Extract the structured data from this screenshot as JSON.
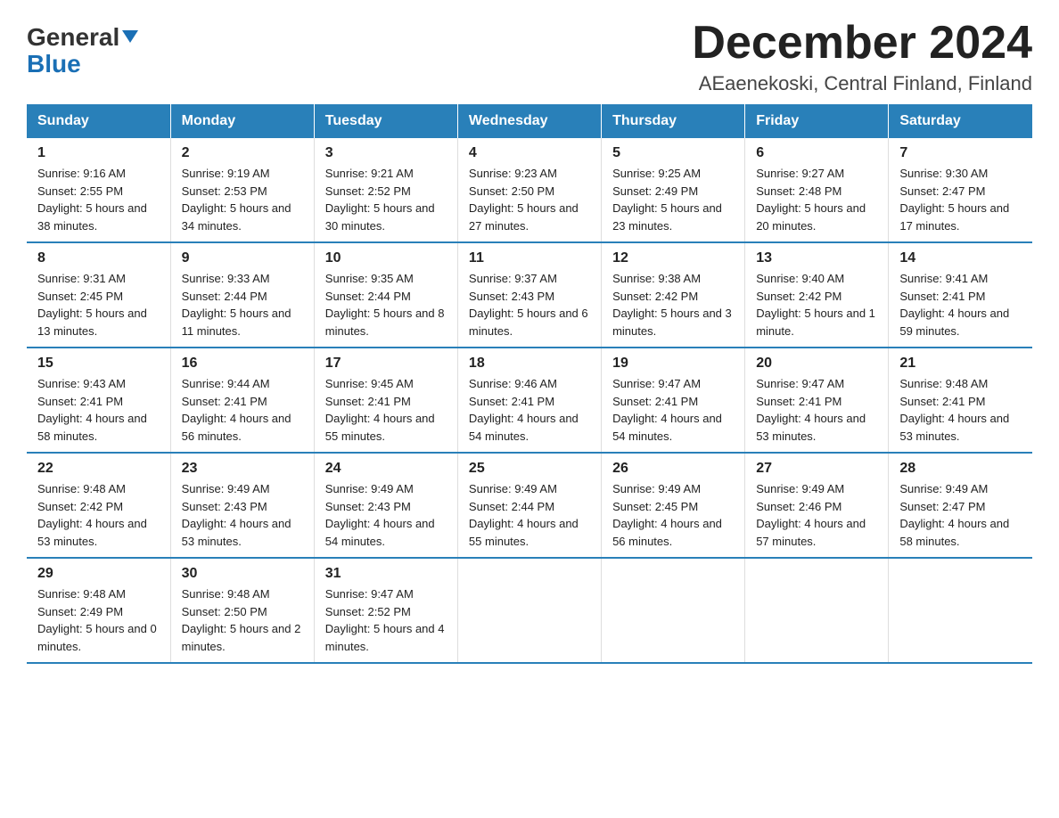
{
  "header": {
    "logo_general": "General",
    "logo_blue": "Blue",
    "title": "December 2024",
    "subtitle": "AEaenekoski, Central Finland, Finland"
  },
  "weekdays": [
    "Sunday",
    "Monday",
    "Tuesday",
    "Wednesday",
    "Thursday",
    "Friday",
    "Saturday"
  ],
  "weeks": [
    [
      {
        "day": "1",
        "sunrise": "9:16 AM",
        "sunset": "2:55 PM",
        "daylight": "5 hours and 38 minutes."
      },
      {
        "day": "2",
        "sunrise": "9:19 AM",
        "sunset": "2:53 PM",
        "daylight": "5 hours and 34 minutes."
      },
      {
        "day": "3",
        "sunrise": "9:21 AM",
        "sunset": "2:52 PM",
        "daylight": "5 hours and 30 minutes."
      },
      {
        "day": "4",
        "sunrise": "9:23 AM",
        "sunset": "2:50 PM",
        "daylight": "5 hours and 27 minutes."
      },
      {
        "day": "5",
        "sunrise": "9:25 AM",
        "sunset": "2:49 PM",
        "daylight": "5 hours and 23 minutes."
      },
      {
        "day": "6",
        "sunrise": "9:27 AM",
        "sunset": "2:48 PM",
        "daylight": "5 hours and 20 minutes."
      },
      {
        "day": "7",
        "sunrise": "9:30 AM",
        "sunset": "2:47 PM",
        "daylight": "5 hours and 17 minutes."
      }
    ],
    [
      {
        "day": "8",
        "sunrise": "9:31 AM",
        "sunset": "2:45 PM",
        "daylight": "5 hours and 13 minutes."
      },
      {
        "day": "9",
        "sunrise": "9:33 AM",
        "sunset": "2:44 PM",
        "daylight": "5 hours and 11 minutes."
      },
      {
        "day": "10",
        "sunrise": "9:35 AM",
        "sunset": "2:44 PM",
        "daylight": "5 hours and 8 minutes."
      },
      {
        "day": "11",
        "sunrise": "9:37 AM",
        "sunset": "2:43 PM",
        "daylight": "5 hours and 6 minutes."
      },
      {
        "day": "12",
        "sunrise": "9:38 AM",
        "sunset": "2:42 PM",
        "daylight": "5 hours and 3 minutes."
      },
      {
        "day": "13",
        "sunrise": "9:40 AM",
        "sunset": "2:42 PM",
        "daylight": "5 hours and 1 minute."
      },
      {
        "day": "14",
        "sunrise": "9:41 AM",
        "sunset": "2:41 PM",
        "daylight": "4 hours and 59 minutes."
      }
    ],
    [
      {
        "day": "15",
        "sunrise": "9:43 AM",
        "sunset": "2:41 PM",
        "daylight": "4 hours and 58 minutes."
      },
      {
        "day": "16",
        "sunrise": "9:44 AM",
        "sunset": "2:41 PM",
        "daylight": "4 hours and 56 minutes."
      },
      {
        "day": "17",
        "sunrise": "9:45 AM",
        "sunset": "2:41 PM",
        "daylight": "4 hours and 55 minutes."
      },
      {
        "day": "18",
        "sunrise": "9:46 AM",
        "sunset": "2:41 PM",
        "daylight": "4 hours and 54 minutes."
      },
      {
        "day": "19",
        "sunrise": "9:47 AM",
        "sunset": "2:41 PM",
        "daylight": "4 hours and 54 minutes."
      },
      {
        "day": "20",
        "sunrise": "9:47 AM",
        "sunset": "2:41 PM",
        "daylight": "4 hours and 53 minutes."
      },
      {
        "day": "21",
        "sunrise": "9:48 AM",
        "sunset": "2:41 PM",
        "daylight": "4 hours and 53 minutes."
      }
    ],
    [
      {
        "day": "22",
        "sunrise": "9:48 AM",
        "sunset": "2:42 PM",
        "daylight": "4 hours and 53 minutes."
      },
      {
        "day": "23",
        "sunrise": "9:49 AM",
        "sunset": "2:43 PM",
        "daylight": "4 hours and 53 minutes."
      },
      {
        "day": "24",
        "sunrise": "9:49 AM",
        "sunset": "2:43 PM",
        "daylight": "4 hours and 54 minutes."
      },
      {
        "day": "25",
        "sunrise": "9:49 AM",
        "sunset": "2:44 PM",
        "daylight": "4 hours and 55 minutes."
      },
      {
        "day": "26",
        "sunrise": "9:49 AM",
        "sunset": "2:45 PM",
        "daylight": "4 hours and 56 minutes."
      },
      {
        "day": "27",
        "sunrise": "9:49 AM",
        "sunset": "2:46 PM",
        "daylight": "4 hours and 57 minutes."
      },
      {
        "day": "28",
        "sunrise": "9:49 AM",
        "sunset": "2:47 PM",
        "daylight": "4 hours and 58 minutes."
      }
    ],
    [
      {
        "day": "29",
        "sunrise": "9:48 AM",
        "sunset": "2:49 PM",
        "daylight": "5 hours and 0 minutes."
      },
      {
        "day": "30",
        "sunrise": "9:48 AM",
        "sunset": "2:50 PM",
        "daylight": "5 hours and 2 minutes."
      },
      {
        "day": "31",
        "sunrise": "9:47 AM",
        "sunset": "2:52 PM",
        "daylight": "5 hours and 4 minutes."
      },
      null,
      null,
      null,
      null
    ]
  ]
}
